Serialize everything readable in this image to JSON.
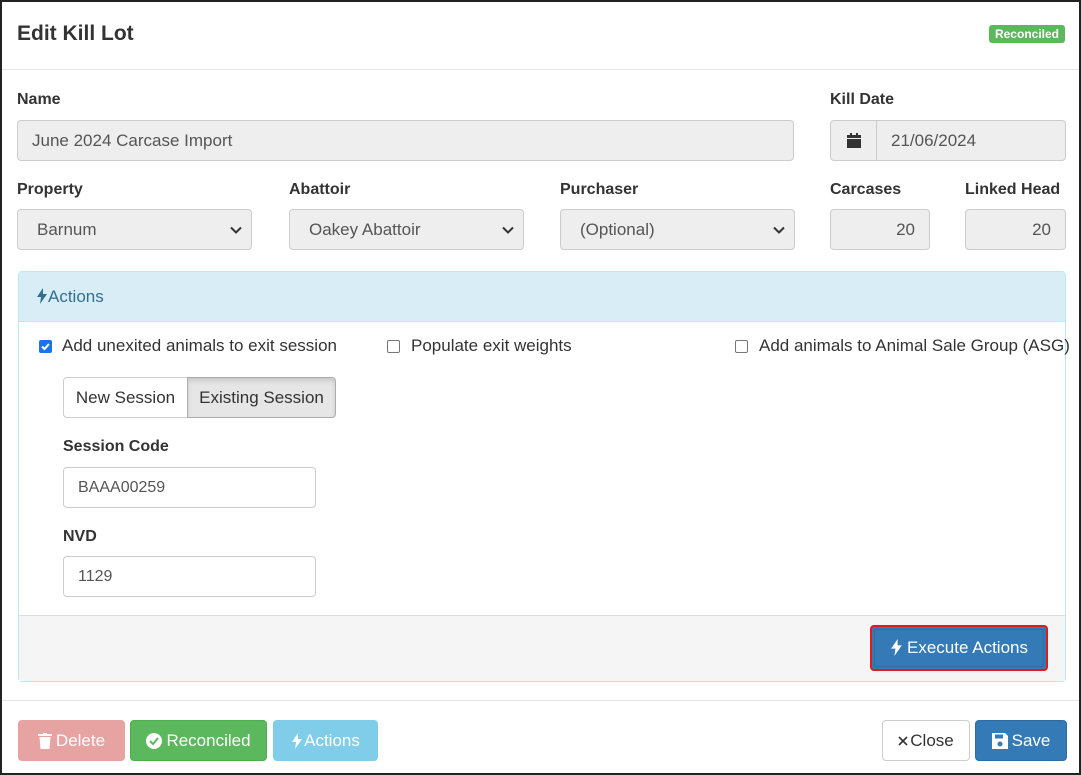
{
  "header": {
    "title": "Edit Kill Lot",
    "status_badge": "Reconciled"
  },
  "form": {
    "name_label": "Name",
    "name_value": "June 2024 Carcase Import",
    "kill_date_label": "Kill Date",
    "kill_date_value": "21/06/2024",
    "property_label": "Property",
    "property_value": "Barnum",
    "abattoir_label": "Abattoir",
    "abattoir_value": "Oakey Abattoir",
    "purchaser_label": "Purchaser",
    "purchaser_value": "(Optional)",
    "carcases_label": "Carcases",
    "carcases_value": "20",
    "linked_head_label": "Linked Head",
    "linked_head_value": "20"
  },
  "actions_panel": {
    "title": "Actions",
    "option_exit_session": {
      "label": "Add unexited animals to exit session",
      "checked": true
    },
    "option_exit_weights": {
      "label": "Populate exit weights",
      "checked": false
    },
    "option_asg": {
      "label": "Add animals to Animal Sale Group (ASG)",
      "checked": false
    },
    "session_toggle": {
      "new_label": "New Session",
      "existing_label": "Existing Session",
      "selected": "Existing Session"
    },
    "session_code_label": "Session Code",
    "session_code_value": "BAAA00259",
    "nvd_label": "NVD",
    "nvd_value": "1129",
    "execute_label": "Execute Actions"
  },
  "footer": {
    "delete_label": "Delete",
    "reconciled_label": "Reconciled",
    "actions_label": "Actions",
    "close_label": "Close",
    "save_label": "Save"
  },
  "colors": {
    "success": "#5cb85c",
    "primary": "#337ab7",
    "info_bg": "#d9edf7",
    "danger_light": "#e7a3a1",
    "info_light": "#7fcde8",
    "highlight": "#e01b1b"
  },
  "icons": [
    "calendar-icon",
    "chevron-down-icon",
    "bolt-icon",
    "trash-icon",
    "check-circle-icon",
    "close-icon",
    "save-icon"
  ]
}
